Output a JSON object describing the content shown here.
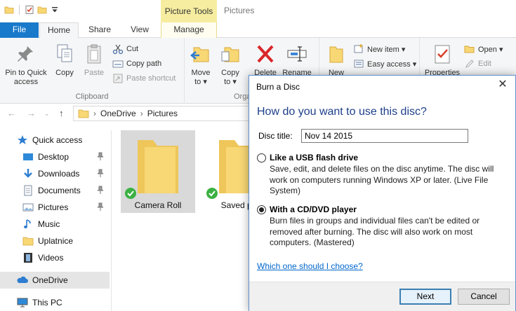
{
  "window": {
    "title": "Pictures",
    "context_group": "Picture Tools"
  },
  "tabs": {
    "file": "File",
    "home": "Home",
    "share": "Share",
    "view": "View",
    "manage": "Manage"
  },
  "ribbon": {
    "clipboard": {
      "label": "Clipboard",
      "pin_line1": "Pin to Quick",
      "pin_line2": "access",
      "copy": "Copy",
      "paste": "Paste",
      "cut": "Cut",
      "copy_path": "Copy path",
      "paste_shortcut": "Paste shortcut"
    },
    "organize": {
      "label": "Orga",
      "move_to": "Move",
      "move_to_2": "to ▾",
      "copy_to": "Copy",
      "copy_to_2": "to ▾",
      "delete": "Delete",
      "rename": "Rename"
    },
    "new": {
      "new_folder": "New",
      "new_item": "New item ▾",
      "easy_access": "Easy access ▾"
    },
    "open": {
      "properties": "Properties",
      "open": "Open ▾",
      "edit": "Edit"
    }
  },
  "address": {
    "crumbs": [
      "OneDrive",
      "Pictures"
    ],
    "sep": "›"
  },
  "navpane": {
    "quick_access": "Quick access",
    "items": [
      {
        "label": "Desktop",
        "pinned": true
      },
      {
        "label": "Downloads",
        "pinned": true
      },
      {
        "label": "Documents",
        "pinned": true
      },
      {
        "label": "Pictures",
        "pinned": true
      },
      {
        "label": "Music",
        "pinned": false
      },
      {
        "label": "Uplatnice",
        "pinned": false
      },
      {
        "label": "Videos",
        "pinned": false
      }
    ],
    "onedrive": "OneDrive",
    "this_pc": "This PC"
  },
  "files": [
    {
      "name": "Camera Roll",
      "selected": true
    },
    {
      "name": "Saved pic",
      "selected": false
    }
  ],
  "dialog": {
    "title": "Burn a Disc",
    "close": "✕",
    "heading": "How do you want to use this disc?",
    "disc_title_label": "Disc title:",
    "disc_title_value": "Nov 14 2015",
    "option1": {
      "title": "Like a USB flash drive",
      "desc": "Save, edit, and delete files on the disc anytime. The disc will work on computers running Windows XP or later. (Live File System)",
      "checked": false
    },
    "option2": {
      "title": "With a CD/DVD player",
      "desc": "Burn files in groups and individual files can't be edited or removed after burning. The disc will also work on most computers. (Mastered)",
      "checked": true
    },
    "help_link": "Which one should I choose?",
    "next": "Next",
    "cancel": "Cancel"
  },
  "colors": {
    "accent": "#1979ca",
    "context_tab": "#f6eda0",
    "folder": "#f8d775",
    "heading": "#1e3f8a",
    "link": "#0066cc",
    "check": "#3bb143"
  }
}
